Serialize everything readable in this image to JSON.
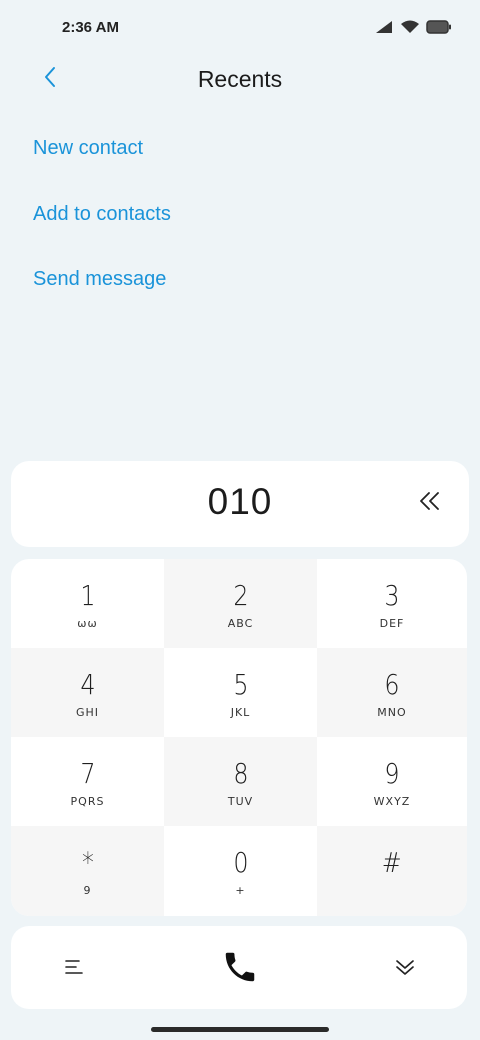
{
  "status": {
    "time": "2:36 AM",
    "icons": [
      "signal-icon",
      "wifi-icon",
      "battery-icon"
    ]
  },
  "header": {
    "title": "Recents",
    "back_icon": "chevron-left-icon"
  },
  "actions": {
    "new_contact": "New contact",
    "add_to_contacts": "Add to contacts",
    "send_message": "Send message"
  },
  "dialer": {
    "number": "010",
    "backspace_icon": "double-chevron-left-icon"
  },
  "keypad": [
    {
      "digit": "1",
      "letters": "ωω"
    },
    {
      "digit": "2",
      "letters": "ABC"
    },
    {
      "digit": "3",
      "letters": "DEF"
    },
    {
      "digit": "4",
      "letters": "GHI"
    },
    {
      "digit": "5",
      "letters": "JKL"
    },
    {
      "digit": "6",
      "letters": "MNO"
    },
    {
      "digit": "7",
      "letters": "PQRS"
    },
    {
      "digit": "8",
      "letters": "TUV"
    },
    {
      "digit": "9",
      "letters": "WXYZ"
    },
    {
      "digit": "*",
      "letters": "9"
    },
    {
      "digit": "0",
      "letters": "+"
    },
    {
      "digit": "#",
      "letters": ""
    }
  ],
  "bottom_bar": {
    "menu_icon": "menu-icon",
    "call_icon": "phone-icon",
    "collapse_icon": "double-chevron-down-icon"
  },
  "colors": {
    "accent": "#1a93d9",
    "background": "#eef4f7",
    "card": "#ffffff",
    "key_alt": "#f6f6f6"
  }
}
